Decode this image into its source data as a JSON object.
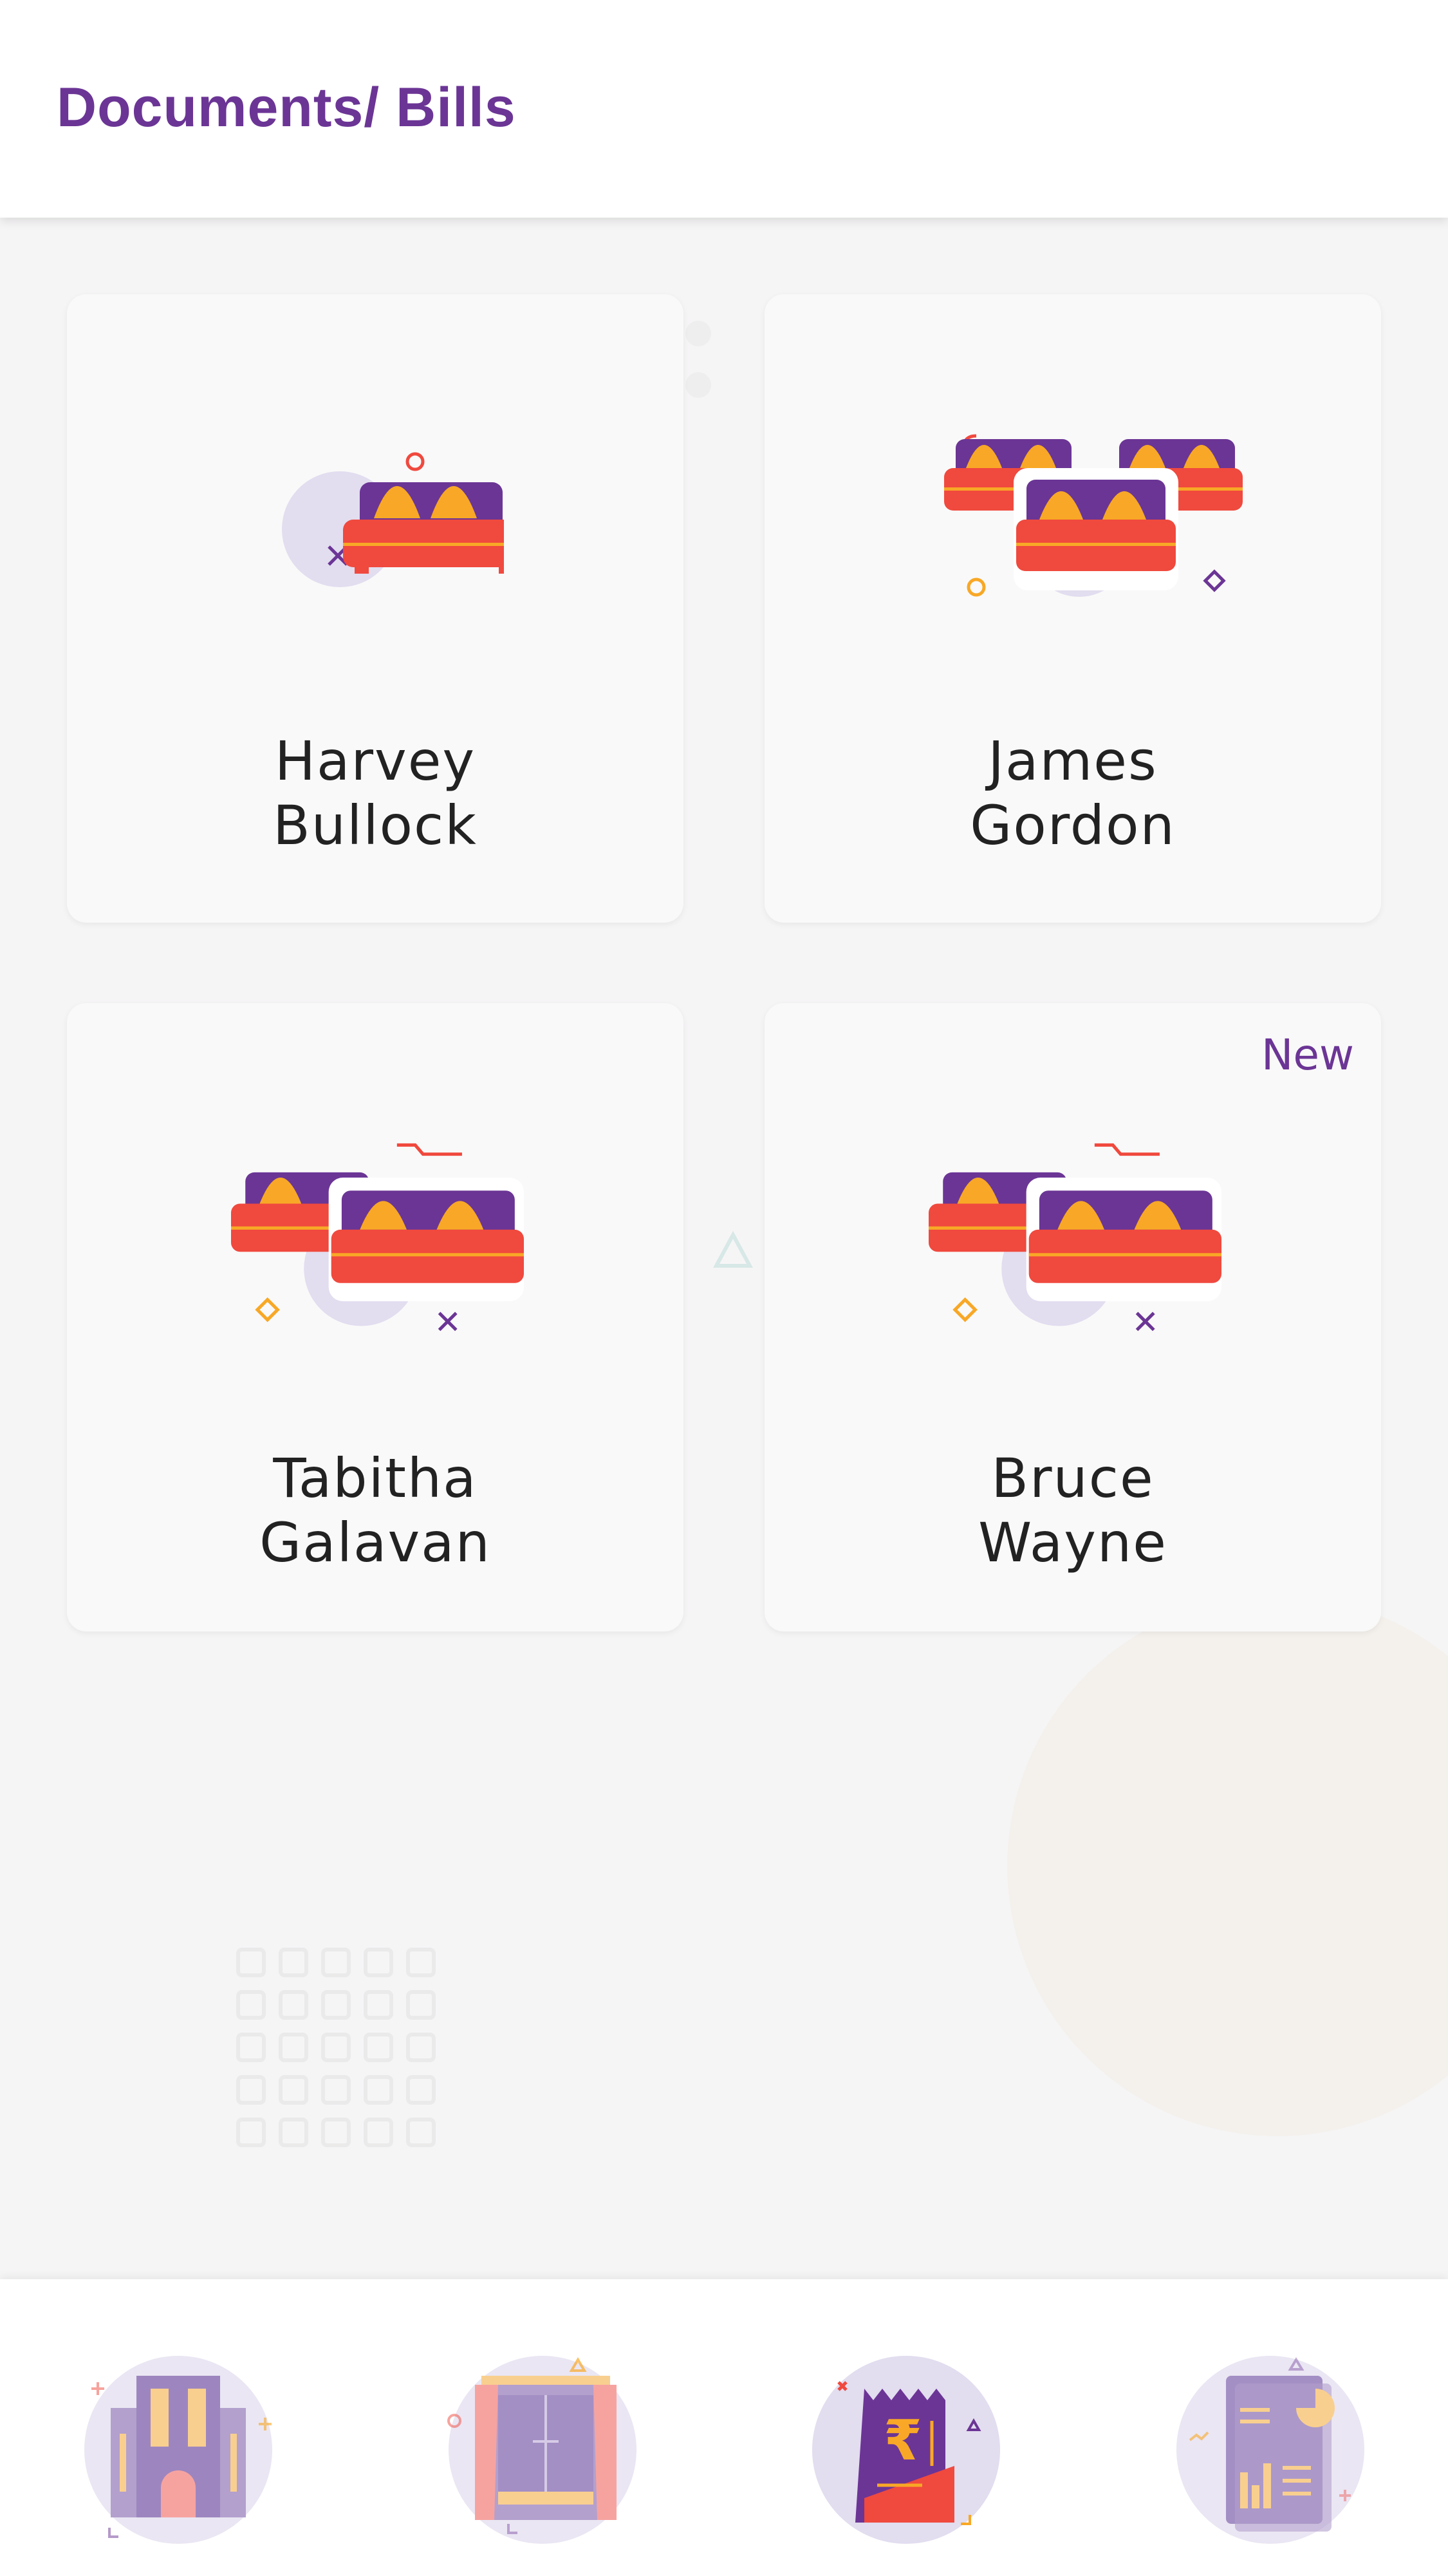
{
  "header": {
    "title": "Documents/ Bills"
  },
  "cards": [
    {
      "name_line1": "Harvey",
      "name_line2": "Bullock",
      "icon": "single-bed-icon",
      "badge": ""
    },
    {
      "name_line1": "James",
      "name_line2": "Gordon",
      "icon": "three-beds-icon",
      "badge": ""
    },
    {
      "name_line1": "Tabitha",
      "name_line2": "Galavan",
      "icon": "two-beds-icon",
      "badge": ""
    },
    {
      "name_line1": "Bruce",
      "name_line2": "Wayne",
      "icon": "two-beds-icon",
      "badge": "New"
    }
  ],
  "bottom_nav": [
    {
      "icon": "building-icon",
      "active": false
    },
    {
      "icon": "room-icon",
      "active": false
    },
    {
      "icon": "bill-rupee-icon",
      "active": true
    },
    {
      "icon": "report-chart-icon",
      "active": false
    }
  ],
  "colors": {
    "accent": "#6b3595",
    "bed_purple": "#6b3595",
    "bed_red": "#f0493e",
    "pillow": "#f8a826",
    "circle": "#e2ddef"
  }
}
